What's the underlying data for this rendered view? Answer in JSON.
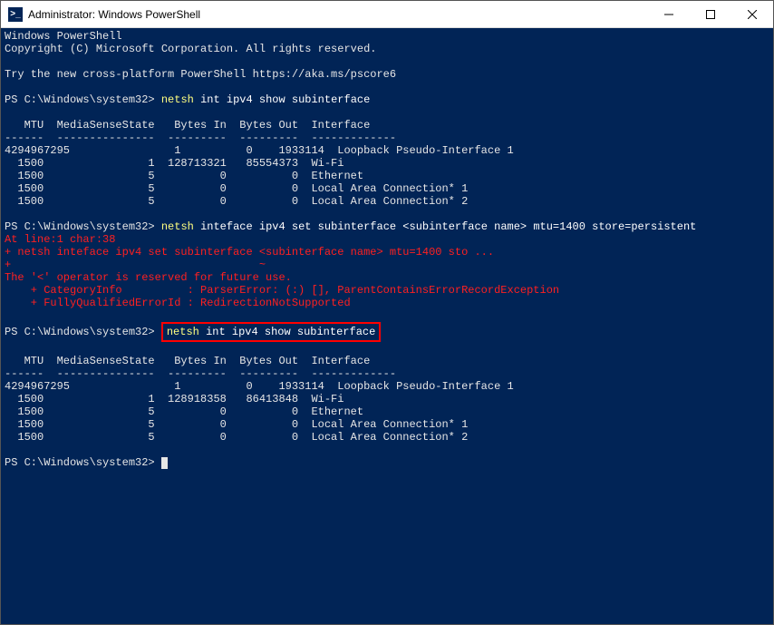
{
  "window": {
    "title": "Administrator: Windows PowerShell",
    "icon_glyph": ">_"
  },
  "header": {
    "line1": "Windows PowerShell",
    "line2": "Copyright (C) Microsoft Corporation. All rights reserved.",
    "line3": "Try the new cross-platform PowerShell https://aka.ms/pscore6"
  },
  "prompt_path": "PS C:\\Windows\\system32>",
  "cmd1": {
    "exe": "netsh",
    "args": "int ipv4 show subinterface"
  },
  "table_header": "   MTU  MediaSenseState   Bytes In  Bytes Out  Interface",
  "table1_row1": "4294967295                1          0    1933114  Loopback Pseudo-Interface 1",
  "table1_row2": "  1500                1  128713321   85554373  Wi-Fi",
  "table1_row3": "  1500                5          0          0  Ethernet",
  "table1_row4": "  1500                5          0          0  Local Area Connection* 1",
  "table1_row5": "  1500                5          0          0  Local Area Connection* 2",
  "cmd2": {
    "exe": "netsh",
    "args": "inteface ipv4 set subinterface <subinterface name> mtu=1400 store=persistent"
  },
  "err": {
    "l1": "At line:1 char:38",
    "l2": "+ netsh inteface ipv4 set subinterface <subinterface name> mtu=1400 sto ...",
    "l3": "+                                      ~",
    "l4": "The '<' operator is reserved for future use.",
    "l5": "    + CategoryInfo          : ParserError: (:) [], ParentContainsErrorRecordException",
    "l6": "    + FullyQualifiedErrorId : RedirectionNotSupported"
  },
  "cmd3": {
    "exe": "netsh",
    "args": "int ipv4 show subinterface"
  },
  "table2_row1": "4294967295                1          0    1933114  Loopback Pseudo-Interface 1",
  "table2_row2": "  1500                1  128918358   86413848  Wi-Fi",
  "table2_row3": "  1500                5          0          0  Ethernet",
  "table2_row4": "  1500                5          0          0  Local Area Connection* 1",
  "table2_row5": "  1500                5          0          0  Local Area Connection* 2"
}
